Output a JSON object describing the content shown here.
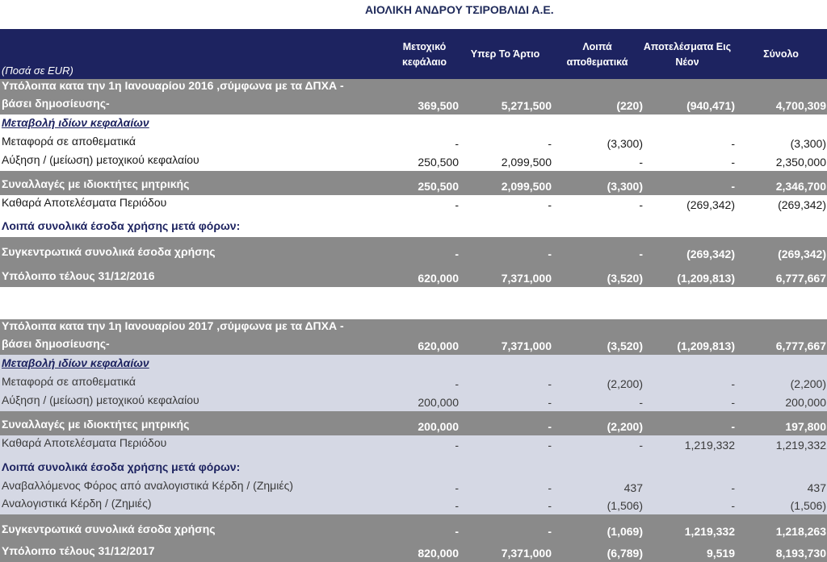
{
  "title": "ΑΙΟΛΙΚΗ ΑΝΔΡΟΥ ΤΣΙΡΟΒΛΙΔΙ Α.Ε.",
  "header": {
    "caption": "(Ποσά σε EUR)",
    "columns": [
      "Μετοχικό\nκεφάλαιο",
      "Υπερ Το Άρτιο",
      "Λοιπά\nαποθεματικά",
      "Αποτελέσματα Εις\nΝέον",
      "Σύνολο"
    ]
  },
  "rows": [
    {
      "label": "Υπόλοιπα κατα την 1η Ιανουαρίου 2016 ,σύμφωνα με τα ΔΠΧΑ -\nβάσει δημοσίευσης-",
      "values": [
        "369,500",
        "5,271,500",
        "(220)",
        "(940,471)",
        "4,700,309"
      ]
    },
    {
      "label": "Μεταβολή ιδίων κεφαλαίων",
      "values": [
        "",
        "",
        "",
        "",
        ""
      ]
    },
    {
      "label": "Μεταφορά σε αποθεματικά",
      "values": [
        "-",
        "-",
        "(3,300)",
        "-",
        "(3,300)"
      ]
    },
    {
      "label": "Αύξηση / (μείωση) μετοχικού κεφαλαίου",
      "values": [
        "250,500",
        "2,099,500",
        "-",
        "-",
        "2,350,000"
      ]
    },
    {
      "label": "Συναλλαγές με ιδιοκτήτες μητρικής",
      "values": [
        "250,500",
        "2,099,500",
        "(3,300)",
        "-",
        "2,346,700"
      ]
    },
    {
      "label": "Καθαρά Αποτελέσματα Περιόδου",
      "values": [
        "-",
        "-",
        "-",
        "(269,342)",
        "(269,342)"
      ]
    },
    {
      "label": "Λοιπά συνολικά έσοδα χρήσης μετά φόρων:",
      "values": [
        "",
        "",
        "",
        "",
        ""
      ]
    },
    {
      "label": "Συγκεντρωτικά συνολικά έσοδα χρήσης",
      "values": [
        "-",
        "-",
        "-",
        "(269,342)",
        "(269,342)"
      ]
    },
    {
      "label": "Υπόλοιπο τέλους 31/12/2016",
      "values": [
        "620,000",
        "7,371,000",
        "(3,520)",
        "(1,209,813)",
        "6,777,667"
      ]
    },
    {
      "label": "Υπόλοιπα κατα την 1η Ιανουαρίου 2017 ,σύμφωνα με τα ΔΠΧΑ -\nβάσει δημοσίευσης-",
      "values": [
        "620,000",
        "7,371,000",
        "(3,520)",
        "(1,209,813)",
        "6,777,667"
      ]
    },
    {
      "label": "Μεταβολή ιδίων κεφαλαίων",
      "values": [
        "",
        "",
        "",
        "",
        ""
      ]
    },
    {
      "label": "Μεταφορά σε αποθεματικά",
      "values": [
        "-",
        "-",
        "(2,200)",
        "-",
        "(2,200)"
      ]
    },
    {
      "label": "Αύξηση / (μείωση) μετοχικού κεφαλαίου",
      "values": [
        "200,000",
        "-",
        "-",
        "-",
        "200,000"
      ]
    },
    {
      "label": "Συναλλαγές με ιδιοκτήτες μητρικής",
      "values": [
        "200,000",
        "-",
        "(2,200)",
        "-",
        "197,800"
      ]
    },
    {
      "label": "Καθαρά Αποτελέσματα Περιόδου",
      "values": [
        "-",
        "-",
        "-",
        "1,219,332",
        "1,219,332"
      ]
    },
    {
      "label": "Λοιπά συνολικά έσοδα χρήσης μετά φόρων:",
      "values": [
        "",
        "",
        "",
        "",
        ""
      ]
    },
    {
      "label": "Αναβαλλόμενος Φόρος από αναλογιστικά Κέρδη / (Ζημιές)",
      "values": [
        "-",
        "-",
        "437",
        "-",
        "437"
      ]
    },
    {
      "label": "Αναλογιστικά Κέρδη / (Ζημιές)",
      "values": [
        "-",
        "-",
        "(1,506)",
        "-",
        "(1,506)"
      ]
    },
    {
      "label": "Συγκεντρωτικά συνολικά έσοδα χρήσης",
      "values": [
        "-",
        "-",
        "(1,069)",
        "1,219,332",
        "1,218,263"
      ]
    },
    {
      "label": "Υπόλοιπο τέλους 31/12/2017",
      "values": [
        "820,000",
        "7,371,000",
        "(6,789)",
        "9,519",
        "8,193,730"
      ]
    }
  ]
}
